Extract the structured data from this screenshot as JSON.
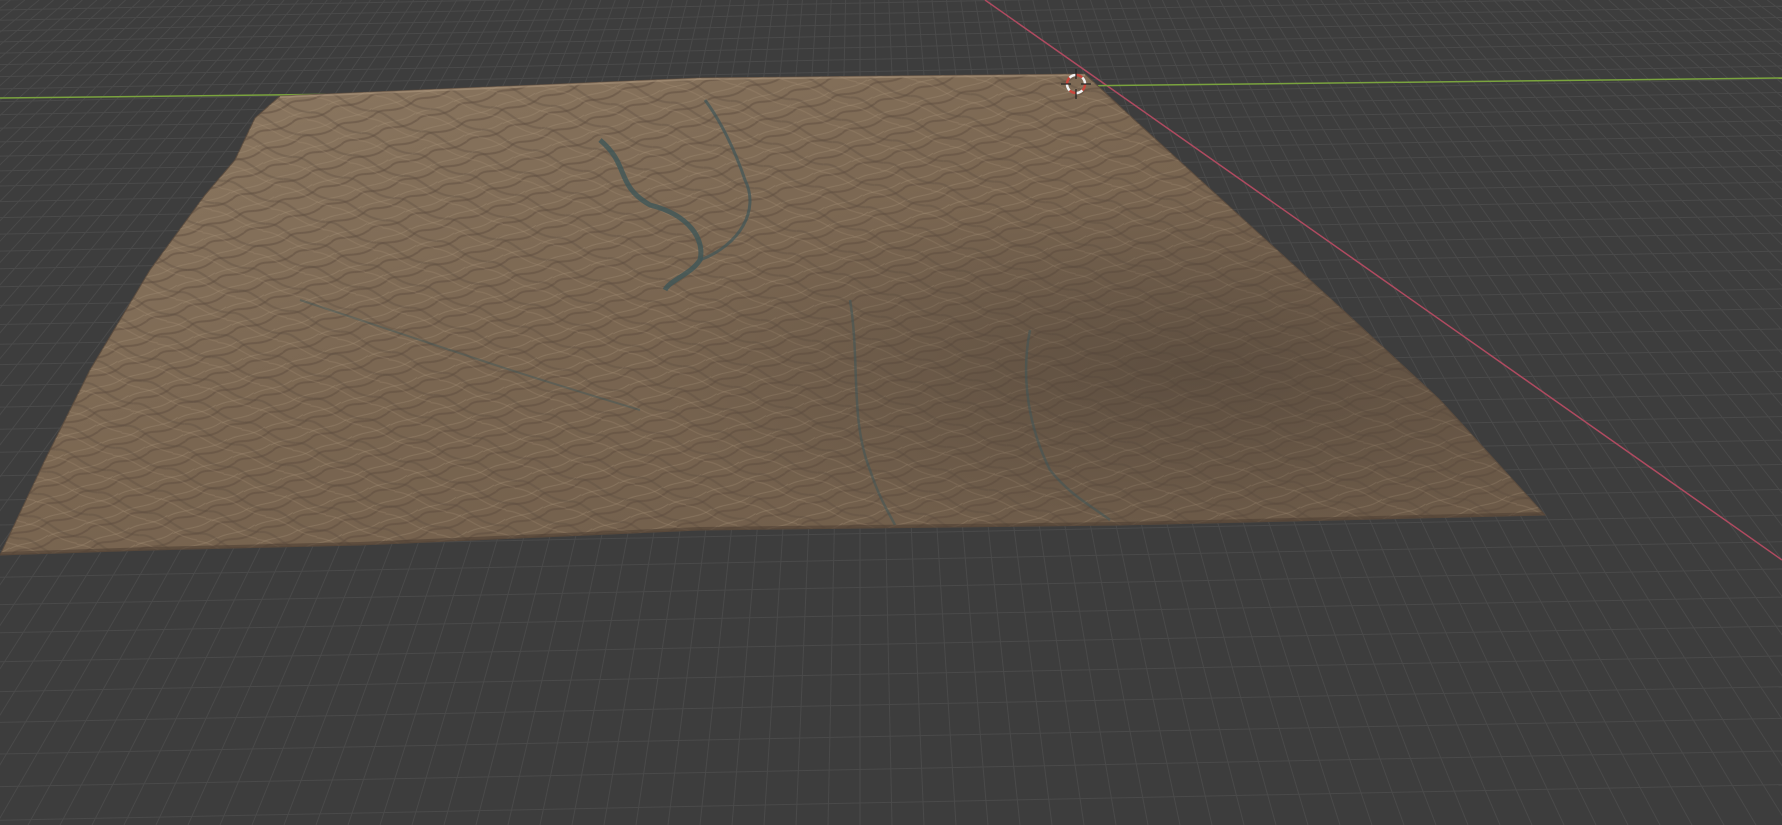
{
  "app": {
    "view": "3d-viewport",
    "background_color": "#3d3d3d"
  },
  "viewport": {
    "grid": true,
    "grid_color": "#4a4a4a",
    "x_axis_color": "#b04a60",
    "y_axis_color": "#7aa33e",
    "object": {
      "kind": "terrain-mesh",
      "icon": "terrain-mesh",
      "colors": {
        "base": "#7b6a55",
        "light": "#9a8670",
        "shadow": "#54463a",
        "river": "#3f5658"
      }
    },
    "cursor": {
      "icon": "3d-cursor-icon",
      "color_a": "#c9463c",
      "color_b": "#f2f2f2"
    }
  }
}
